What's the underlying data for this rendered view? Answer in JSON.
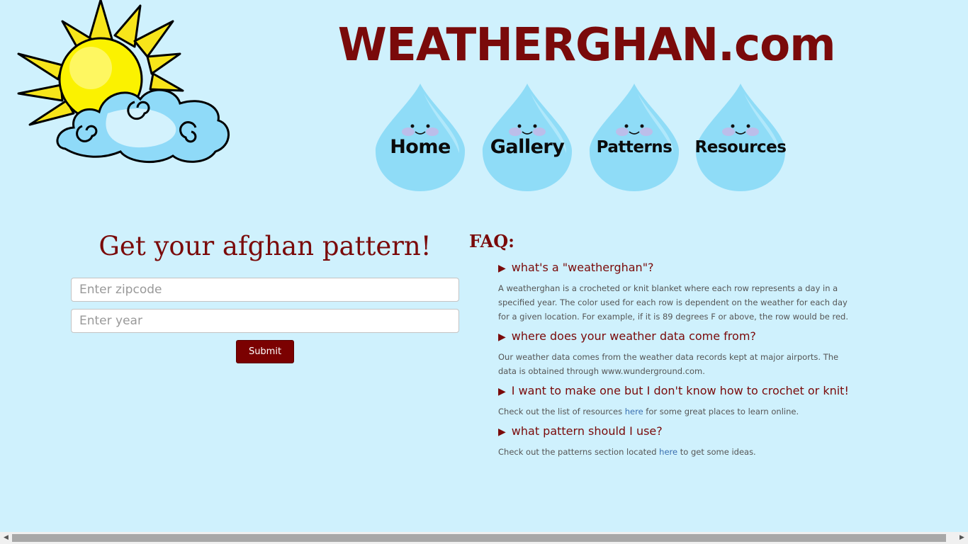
{
  "header": {
    "site_title": "WEATHERGHAN.com"
  },
  "nav": {
    "items": [
      {
        "label": "Home"
      },
      {
        "label": "Gallery"
      },
      {
        "label": "Patterns"
      },
      {
        "label": "Resources"
      }
    ]
  },
  "form": {
    "title": "Get your afghan pattern!",
    "zipcode_placeholder": "Enter zipcode",
    "year_placeholder": "Enter year",
    "submit_label": "Submit"
  },
  "faq": {
    "title": "FAQ:",
    "items": [
      {
        "question": "what's a \"weatherghan\"?",
        "answer": "A weatherghan is a crocheted or knit blanket where each row represents a day in a specified year. The color used for each row is dependent on the weather for each day for a given location. For example, if it is 89 degrees F or above, the row would be red."
      },
      {
        "question": "where does your weather data come from?",
        "answer": "Our weather data comes from the weather data records kept at major airports. The data is obtained through www.wunderground.com."
      },
      {
        "question": "I want to make one but I don't know how to crochet or knit!",
        "answer_before": "Check out the list of resources ",
        "answer_link": "here",
        "answer_after": " for some great places to learn online."
      },
      {
        "question": "what pattern should I use?",
        "answer_before": "Check out the patterns section located ",
        "answer_link": "here",
        "answer_after": " to get some ideas."
      }
    ]
  },
  "icons": {
    "arrow": "▶",
    "scroll_left": "◀",
    "scroll_right": "▶"
  },
  "colors": {
    "background": "#cff1fd",
    "accent": "#7a0a0a",
    "drop": "#8fdcf7"
  }
}
